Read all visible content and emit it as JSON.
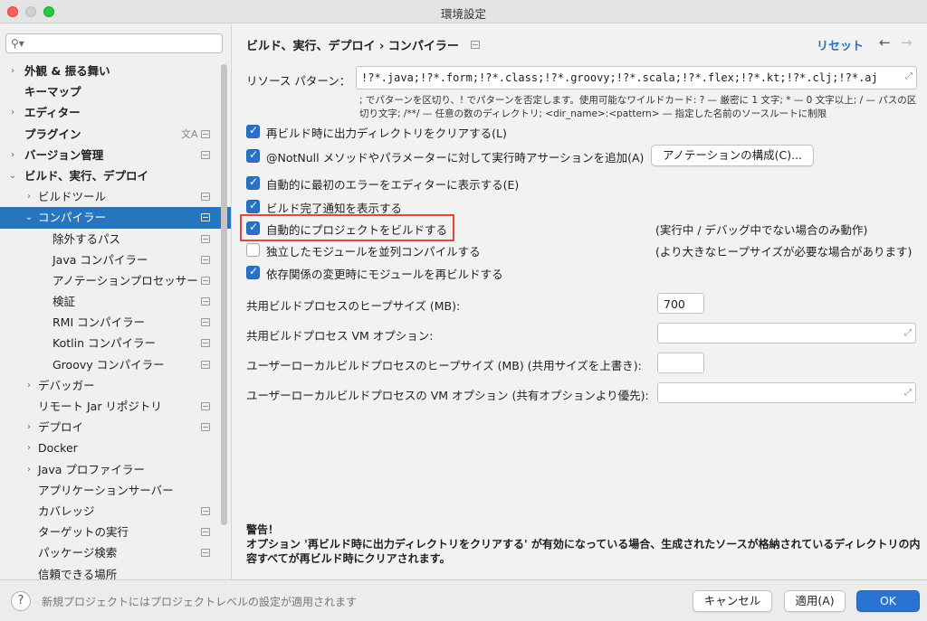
{
  "window": {
    "title": "環境設定"
  },
  "sidebar": {
    "search_placeholder": "",
    "items": [
      {
        "label": "外観 & 振る舞い",
        "level": 0,
        "arrow": "›",
        "bold": true,
        "badge": false
      },
      {
        "label": "キーマップ",
        "level": 0,
        "arrow": "",
        "bold": true,
        "badge": false
      },
      {
        "label": "エディター",
        "level": 0,
        "arrow": "›",
        "bold": true,
        "badge": false
      },
      {
        "label": "プラグイン",
        "level": 0,
        "arrow": "",
        "bold": true,
        "badge": true,
        "translate_icon": true
      },
      {
        "label": "バージョン管理",
        "level": 0,
        "arrow": "›",
        "bold": true,
        "badge": true
      },
      {
        "label": "ビルド、実行、デプロイ",
        "level": 0,
        "arrow": "⌄",
        "bold": true,
        "badge": false
      },
      {
        "label": "ビルドツール",
        "level": 1,
        "arrow": "›",
        "bold": false,
        "badge": true
      },
      {
        "label": "コンパイラー",
        "level": 1,
        "arrow": "⌄",
        "bold": false,
        "badge": true,
        "selected": true
      },
      {
        "label": "除外するパス",
        "level": 2,
        "arrow": "",
        "bold": false,
        "badge": true
      },
      {
        "label": "Java コンパイラー",
        "level": 2,
        "arrow": "",
        "bold": false,
        "badge": true
      },
      {
        "label": "アノテーションプロセッサー",
        "level": 2,
        "arrow": "",
        "bold": false,
        "badge": true
      },
      {
        "label": "検証",
        "level": 2,
        "arrow": "",
        "bold": false,
        "badge": true
      },
      {
        "label": "RMI コンパイラー",
        "level": 2,
        "arrow": "",
        "bold": false,
        "badge": true
      },
      {
        "label": "Kotlin コンパイラー",
        "level": 2,
        "arrow": "",
        "bold": false,
        "badge": true
      },
      {
        "label": "Groovy コンパイラー",
        "level": 2,
        "arrow": "",
        "bold": false,
        "badge": true
      },
      {
        "label": "デバッガー",
        "level": 1,
        "arrow": "›",
        "bold": false,
        "badge": false
      },
      {
        "label": "リモート Jar リポジトリ",
        "level": 1,
        "arrow": "",
        "bold": false,
        "badge": true
      },
      {
        "label": "デプロイ",
        "level": 1,
        "arrow": "›",
        "bold": false,
        "badge": true
      },
      {
        "label": "Docker",
        "level": 1,
        "arrow": "›",
        "bold": false,
        "badge": false
      },
      {
        "label": "Java プロファイラー",
        "level": 1,
        "arrow": "›",
        "bold": false,
        "badge": false
      },
      {
        "label": "アプリケーションサーバー",
        "level": 1,
        "arrow": "",
        "bold": false,
        "badge": false
      },
      {
        "label": "カバレッジ",
        "level": 1,
        "arrow": "",
        "bold": false,
        "badge": true
      },
      {
        "label": "ターゲットの実行",
        "level": 1,
        "arrow": "",
        "bold": false,
        "badge": true
      },
      {
        "label": "パッケージ検索",
        "level": 1,
        "arrow": "",
        "bold": false,
        "badge": true
      },
      {
        "label": "信頼できる場所",
        "level": 1,
        "arrow": "",
        "bold": false,
        "badge": false
      }
    ]
  },
  "header": {
    "breadcrumb": "ビルド、実行、デプロイ  ›  コンパイラー",
    "reset": "リセット",
    "back": "←",
    "forward": "→"
  },
  "resource": {
    "label": "リソース パターン：",
    "value": "!?*.java;!?*.form;!?*.class;!?*.groovy;!?*.scala;!?*.flex;!?*.kt;!?*.clj;!?*.aj",
    "hint": "; でパターンを区切り、! でパターンを否定します。使用可能なワイルドカード: ? — 厳密に 1 文字; * — 0 文字以上; / — パスの区切り文字; /**/ — 任意の数のディレクトリ; <dir_name>:<pattern> — 指定した名前のソースルートに制限"
  },
  "options": [
    {
      "label": "再ビルド時に出力ディレクトリをクリアする(L)",
      "checked": true,
      "note": ""
    },
    {
      "label": "@NotNull メソッドやパラメーターに対して実行時アサーションを追加(A)",
      "checked": true,
      "note": "",
      "button": "アノテーションの構成(C)..."
    },
    {
      "label": "自動的に最初のエラーをエディターに表示する(E)",
      "checked": true,
      "note": ""
    },
    {
      "label": "ビルド完了通知を表示する",
      "checked": true,
      "note": ""
    },
    {
      "label": "自動的にプロジェクトをビルドする",
      "checked": true,
      "note": "(実行中 / デバッグ中でない場合のみ動作)"
    },
    {
      "label": "独立したモジュールを並列コンパイルする",
      "checked": false,
      "note": "(より大きなヒープサイズが必要な場合があります)"
    },
    {
      "label": "依存関係の変更時にモジュールを再ビルドする",
      "checked": true,
      "note": ""
    }
  ],
  "fields": [
    {
      "label": "共用ビルドプロセスのヒープサイズ (MB):",
      "value": "700"
    },
    {
      "label": "共用ビルドプロセス VM オプション:",
      "value": ""
    },
    {
      "label": "ユーザーローカルビルドプロセスのヒープサイズ (MB) (共用サイズを上書き):",
      "value": ""
    },
    {
      "label": "ユーザーローカルビルドプロセスの VM オプション (共有オプションより優先):",
      "value": ""
    }
  ],
  "warning": {
    "title": "警告！",
    "text": "オプション '再ビルド時に出力ディレクトリをクリアする' が有効になっている場合、生成されたソースが格納されているディレクトリの内容すべてが再ビルド時にクリアされます。"
  },
  "footer": {
    "help": "?",
    "status": "新規プロジェクトにはプロジェクトレベルの設定が適用されます",
    "cancel": "キャンセル",
    "apply": "適用(A)",
    "ok": "OK"
  },
  "colors": {
    "accent": "#2675bf",
    "primary_button": "#2b73d2",
    "highlight": "#e4473a"
  }
}
